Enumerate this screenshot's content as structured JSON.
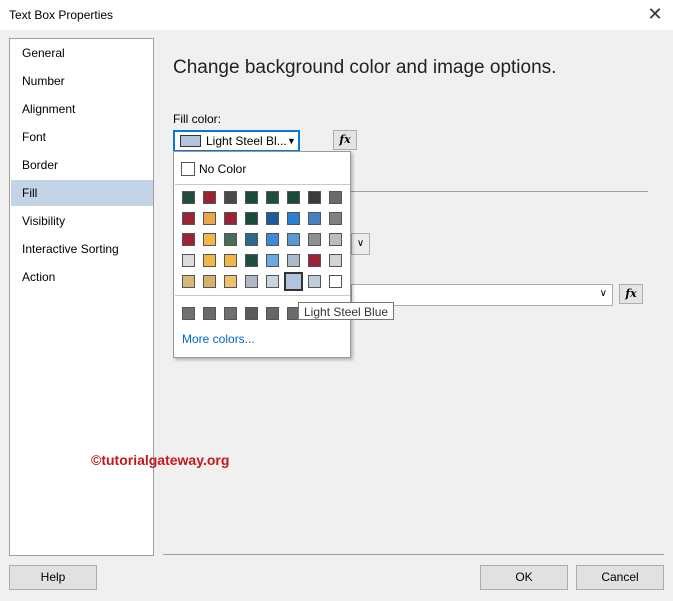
{
  "window": {
    "title": "Text Box Properties",
    "close_symbol": "✕"
  },
  "nav": {
    "items": [
      "General",
      "Number",
      "Alignment",
      "Font",
      "Border",
      "Fill",
      "Visibility",
      "Interactive Sorting",
      "Action"
    ],
    "selected": "Fill"
  },
  "main": {
    "heading": "Change background color and image options.",
    "fill_label": "Fill color:",
    "fill_value": "Light Steel Bl...",
    "fx": "fx"
  },
  "popup": {
    "no_color": "No Color",
    "more_colors": "More colors...",
    "palette": [
      [
        "#1f4e3d",
        "#9b2335",
        "#4a4a4a",
        "#1a4a3a",
        "#1f4e3d",
        "#1a4a3a",
        "#3a3a3a",
        "#6a6a6a"
      ],
      [
        "#9b2335",
        "#e8a84a",
        "#9b2335",
        "#1a4a3a",
        "#1f5a9a",
        "#2a7fd4",
        "#4a7fc0",
        "#808080"
      ],
      [
        "#9b2335",
        "#f0b84a",
        "#4a6a5a",
        "#2a6a8a",
        "#3a8ad4",
        "#5a9ad4",
        "#909090",
        "#b8bec6"
      ],
      [
        "#dcdcdc",
        "#f0b84a",
        "#f0b84a",
        "#1f4e3d",
        "#6aaae0",
        "#a8bccc",
        "#9b2335",
        "#d0d4d8"
      ],
      [
        "#d8b878",
        "#d8b070",
        "#f0c070",
        "#b0b8c8",
        "#c8d4e0",
        "#b0c4de",
        "#c0ccd8",
        "#ffffff"
      ]
    ],
    "recent": [
      "#707070",
      "#6a6a6a",
      "#707070",
      "#5a5a5a",
      "#666666",
      "#6a6a6a"
    ],
    "selected_color": "#b0c4de"
  },
  "tooltip": "Light Steel Blue",
  "watermark": "©tutorialgateway.org",
  "buttons": {
    "help": "Help",
    "ok": "OK",
    "cancel": "Cancel"
  }
}
